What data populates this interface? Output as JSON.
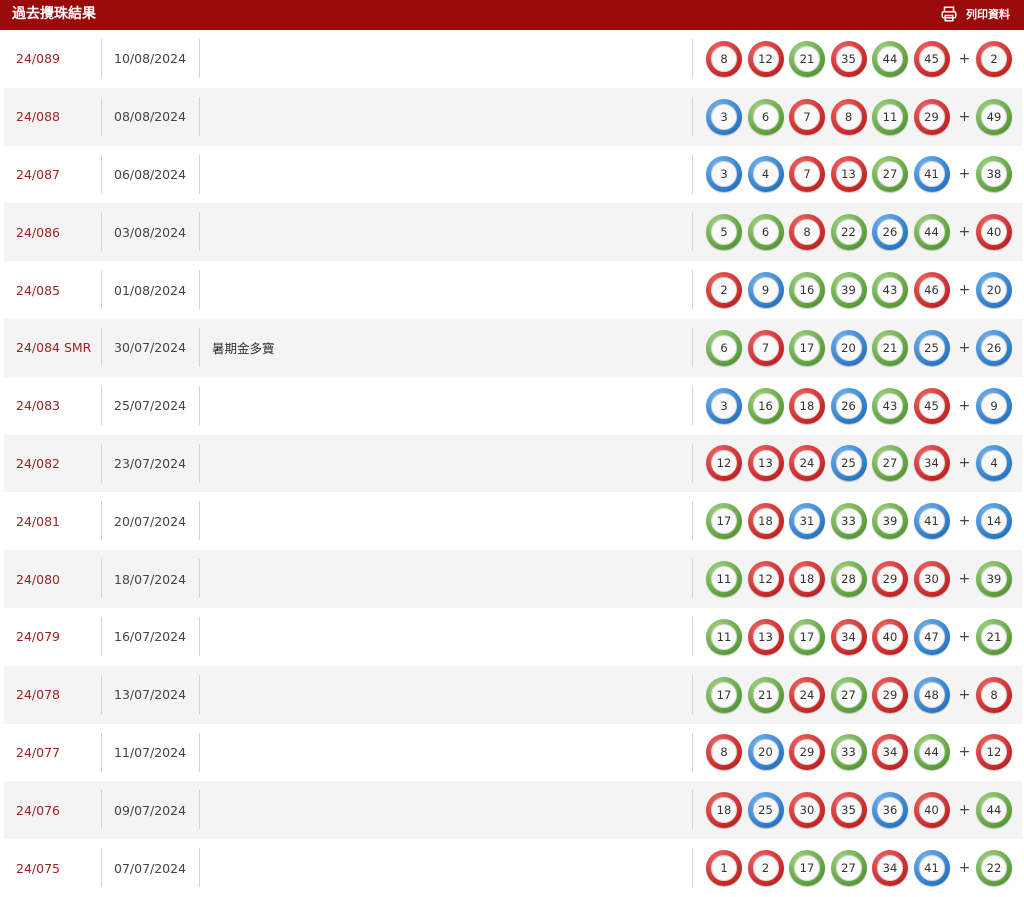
{
  "header": {
    "title": "過去攪珠結果",
    "print_label": "列印資料"
  },
  "rows": [
    {
      "draw": "24/089",
      "date": "10/08/2024",
      "note": "",
      "balls": [
        [
          8,
          "red"
        ],
        [
          12,
          "red"
        ],
        [
          21,
          "green"
        ],
        [
          35,
          "red"
        ],
        [
          44,
          "green"
        ],
        [
          45,
          "red"
        ]
      ],
      "extra": [
        2,
        "red"
      ]
    },
    {
      "draw": "24/088",
      "date": "08/08/2024",
      "note": "",
      "balls": [
        [
          3,
          "blue"
        ],
        [
          6,
          "green"
        ],
        [
          7,
          "red"
        ],
        [
          8,
          "red"
        ],
        [
          11,
          "green"
        ],
        [
          29,
          "red"
        ]
      ],
      "extra": [
        49,
        "green"
      ]
    },
    {
      "draw": "24/087",
      "date": "06/08/2024",
      "note": "",
      "balls": [
        [
          3,
          "blue"
        ],
        [
          4,
          "blue"
        ],
        [
          7,
          "red"
        ],
        [
          13,
          "red"
        ],
        [
          27,
          "green"
        ],
        [
          41,
          "blue"
        ]
      ],
      "extra": [
        38,
        "green"
      ]
    },
    {
      "draw": "24/086",
      "date": "03/08/2024",
      "note": "",
      "balls": [
        [
          5,
          "green"
        ],
        [
          6,
          "green"
        ],
        [
          8,
          "red"
        ],
        [
          22,
          "green"
        ],
        [
          26,
          "blue"
        ],
        [
          44,
          "green"
        ]
      ],
      "extra": [
        40,
        "red"
      ]
    },
    {
      "draw": "24/085",
      "date": "01/08/2024",
      "note": "",
      "balls": [
        [
          2,
          "red"
        ],
        [
          9,
          "blue"
        ],
        [
          16,
          "green"
        ],
        [
          39,
          "green"
        ],
        [
          43,
          "green"
        ],
        [
          46,
          "red"
        ]
      ],
      "extra": [
        20,
        "blue"
      ]
    },
    {
      "draw": "24/084 SMR",
      "date": "30/07/2024",
      "note": "暑期金多寶",
      "balls": [
        [
          6,
          "green"
        ],
        [
          7,
          "red"
        ],
        [
          17,
          "green"
        ],
        [
          20,
          "blue"
        ],
        [
          21,
          "green"
        ],
        [
          25,
          "blue"
        ]
      ],
      "extra": [
        26,
        "blue"
      ]
    },
    {
      "draw": "24/083",
      "date": "25/07/2024",
      "note": "",
      "balls": [
        [
          3,
          "blue"
        ],
        [
          16,
          "green"
        ],
        [
          18,
          "red"
        ],
        [
          26,
          "blue"
        ],
        [
          43,
          "green"
        ],
        [
          45,
          "red"
        ]
      ],
      "extra": [
        9,
        "blue"
      ]
    },
    {
      "draw": "24/082",
      "date": "23/07/2024",
      "note": "",
      "balls": [
        [
          12,
          "red"
        ],
        [
          13,
          "red"
        ],
        [
          24,
          "red"
        ],
        [
          25,
          "blue"
        ],
        [
          27,
          "green"
        ],
        [
          34,
          "red"
        ]
      ],
      "extra": [
        4,
        "blue"
      ]
    },
    {
      "draw": "24/081",
      "date": "20/07/2024",
      "note": "",
      "balls": [
        [
          17,
          "green"
        ],
        [
          18,
          "red"
        ],
        [
          31,
          "blue"
        ],
        [
          33,
          "green"
        ],
        [
          39,
          "green"
        ],
        [
          41,
          "blue"
        ]
      ],
      "extra": [
        14,
        "blue"
      ]
    },
    {
      "draw": "24/080",
      "date": "18/07/2024",
      "note": "",
      "balls": [
        [
          11,
          "green"
        ],
        [
          12,
          "red"
        ],
        [
          18,
          "red"
        ],
        [
          28,
          "green"
        ],
        [
          29,
          "red"
        ],
        [
          30,
          "red"
        ]
      ],
      "extra": [
        39,
        "green"
      ]
    },
    {
      "draw": "24/079",
      "date": "16/07/2024",
      "note": "",
      "balls": [
        [
          11,
          "green"
        ],
        [
          13,
          "red"
        ],
        [
          17,
          "green"
        ],
        [
          34,
          "red"
        ],
        [
          40,
          "red"
        ],
        [
          47,
          "blue"
        ]
      ],
      "extra": [
        21,
        "green"
      ]
    },
    {
      "draw": "24/078",
      "date": "13/07/2024",
      "note": "",
      "balls": [
        [
          17,
          "green"
        ],
        [
          21,
          "green"
        ],
        [
          24,
          "red"
        ],
        [
          27,
          "green"
        ],
        [
          29,
          "red"
        ],
        [
          48,
          "blue"
        ]
      ],
      "extra": [
        8,
        "red"
      ]
    },
    {
      "draw": "24/077",
      "date": "11/07/2024",
      "note": "",
      "balls": [
        [
          8,
          "red"
        ],
        [
          20,
          "blue"
        ],
        [
          29,
          "red"
        ],
        [
          33,
          "green"
        ],
        [
          34,
          "red"
        ],
        [
          44,
          "green"
        ]
      ],
      "extra": [
        12,
        "red"
      ]
    },
    {
      "draw": "24/076",
      "date": "09/07/2024",
      "note": "",
      "balls": [
        [
          18,
          "red"
        ],
        [
          25,
          "blue"
        ],
        [
          30,
          "red"
        ],
        [
          35,
          "red"
        ],
        [
          36,
          "blue"
        ],
        [
          40,
          "red"
        ]
      ],
      "extra": [
        44,
        "green"
      ]
    },
    {
      "draw": "24/075",
      "date": "07/07/2024",
      "note": "",
      "balls": [
        [
          1,
          "red"
        ],
        [
          2,
          "red"
        ],
        [
          17,
          "green"
        ],
        [
          27,
          "green"
        ],
        [
          34,
          "red"
        ],
        [
          41,
          "blue"
        ]
      ],
      "extra": [
        22,
        "green"
      ]
    }
  ]
}
